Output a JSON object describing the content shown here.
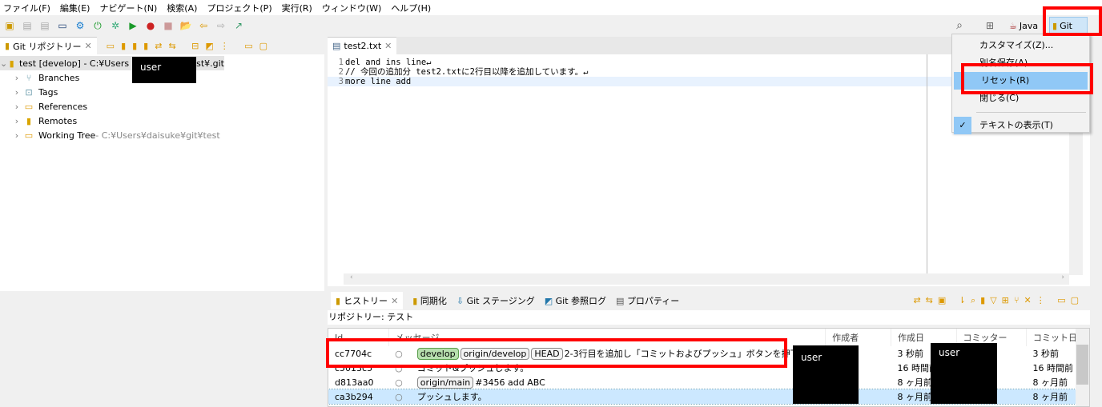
{
  "menubar": [
    "ファイル(F)",
    "編集(E)",
    "ナビゲート(N)",
    "検索(A)",
    "プロジェクト(P)",
    "実行(R)",
    "ウィンドウ(W)",
    "ヘルプ(H)"
  ],
  "perspectives": {
    "java": "Java",
    "git": "Git"
  },
  "perspective_menu": {
    "items": [
      "カスタマイズ(Z)...",
      "別名保存(A)...",
      "リセット(R)",
      "閉じる(C)",
      "テキストの表示(T)"
    ],
    "highlighted": "リセット(R)",
    "checked": "テキストの表示(T)"
  },
  "repo_view": {
    "tab": "Git リポジトリー",
    "root": {
      "label_a": "test [develop] - C:¥Users",
      "label_b": "st¥.git",
      "redacted": "user"
    },
    "children": [
      {
        "label": "Branches",
        "icon": "branches-icon"
      },
      {
        "label": "Tags",
        "icon": "tags-icon"
      },
      {
        "label": "References",
        "icon": "folder-icon"
      },
      {
        "label": "Remotes",
        "icon": "remotes-icon"
      },
      {
        "label": "Working Tree",
        "path": " - C:¥Users¥daisuke¥git¥test",
        "icon": "folder-icon"
      }
    ]
  },
  "editor": {
    "tab": "test2.txt",
    "lines": [
      {
        "n": "1",
        "text": "del and ins line↵"
      },
      {
        "n": "2",
        "text": "// 今回の追加分 test2.txtに2行目以降を追加しています。↵"
      },
      {
        "n": "3",
        "text": "more line add"
      }
    ]
  },
  "bottom": {
    "tabs": [
      "ヒストリー",
      "同期化",
      "Git ステージング",
      "Git 参照ログ",
      "プロパティー"
    ],
    "repo_label": "リポジトリー: テスト",
    "columns": [
      "Id",
      "メッセージ",
      "作成者",
      "作成日",
      "コミッター",
      "コミット日"
    ],
    "rows": [
      {
        "id": "cc7704c",
        "refs": [
          "develop",
          "origin/develop",
          "HEAD"
        ],
        "message": "2-3行目を追加し「コミットおよびプッシュ」ボタンを押下します",
        "created": "3 秒前",
        "committed": "3 秒前"
      },
      {
        "id": "c5013c5",
        "refs": [],
        "message": "コミット&プッシュします。",
        "created": "16 時間前",
        "committed": "16 時間前"
      },
      {
        "id": "d813aa0",
        "refs": [
          "origin/main"
        ],
        "message": "#3456 add ABC",
        "created": "8 ヶ月前",
        "committed": "8 ヶ月前"
      },
      {
        "id": "ca3b294",
        "refs": [],
        "message": "プッシュします。",
        "created": "8 ヶ月前",
        "committed": "8 ヶ月前"
      }
    ],
    "redacted_author": "user",
    "redacted_committer": "user"
  },
  "colors": {
    "highlight": "#90c8f6",
    "selection": "#cce8ff",
    "annotation": "#ff0000",
    "current_branch": "#b7dfae"
  }
}
